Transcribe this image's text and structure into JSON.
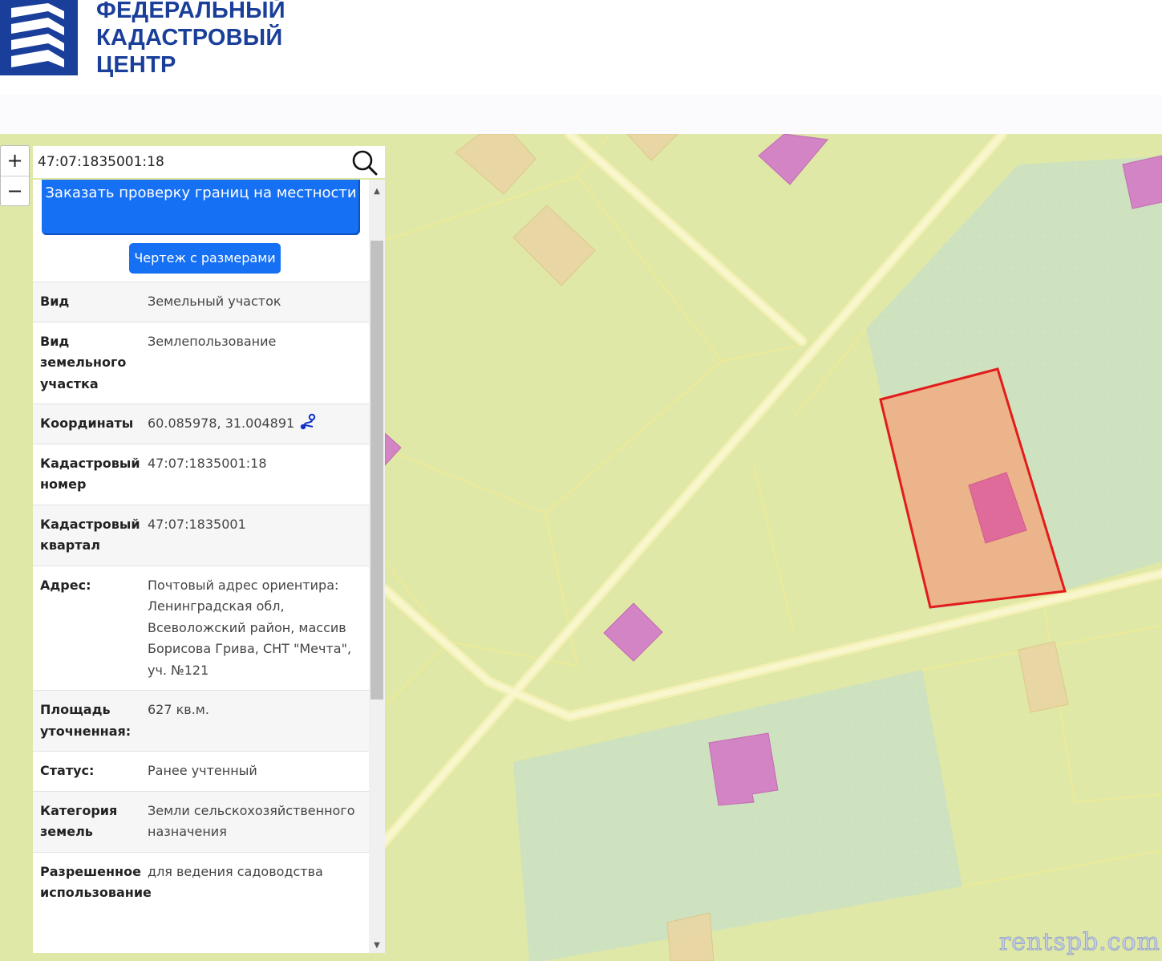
{
  "header": {
    "logo_line1": "ФЕДЕРАЛЬНЫЙ",
    "logo_line2": "КАДАСТРОВЫЙ",
    "logo_line3": "ЦЕНТР",
    "brand_color": "#1a3f9a"
  },
  "map": {
    "watermark": "rentspb.com",
    "zoom_in": "+",
    "zoom_out": "−",
    "highlight_color": "#e21b1b"
  },
  "search": {
    "value": "47:07:1835001:18",
    "icon": "search-icon"
  },
  "panel": {
    "order_button": "Заказать проверку границ на местности",
    "drawing_button": "Чертеж с размерами",
    "rows": [
      {
        "key": "Вид",
        "value": "Земельный участок"
      },
      {
        "key": "Вид земельного участка",
        "value": "Землепользование"
      },
      {
        "key": "Координаты",
        "value": "60.085978, 31.004891"
      },
      {
        "key": "Кадастровый номер",
        "value": "47:07:1835001:18"
      },
      {
        "key": "Кадастровый квартал",
        "value": "47:07:1835001"
      },
      {
        "key": "Адрес:",
        "value": "Почтовый адрес ориентира: Ленинградская обл, Всеволожский район, массив Борисова Грива, СНТ \"Мечта\", уч. №121"
      },
      {
        "key": "Площадь уточненная:",
        "value": "627 кв.м."
      },
      {
        "key": "Статус:",
        "value": "Ранее учтенный"
      },
      {
        "key": "Категория земель",
        "value": "Земли сельскохозяйственного назначения"
      },
      {
        "key": "Разрешенное использование",
        "value": "для ведения садоводства"
      }
    ]
  }
}
